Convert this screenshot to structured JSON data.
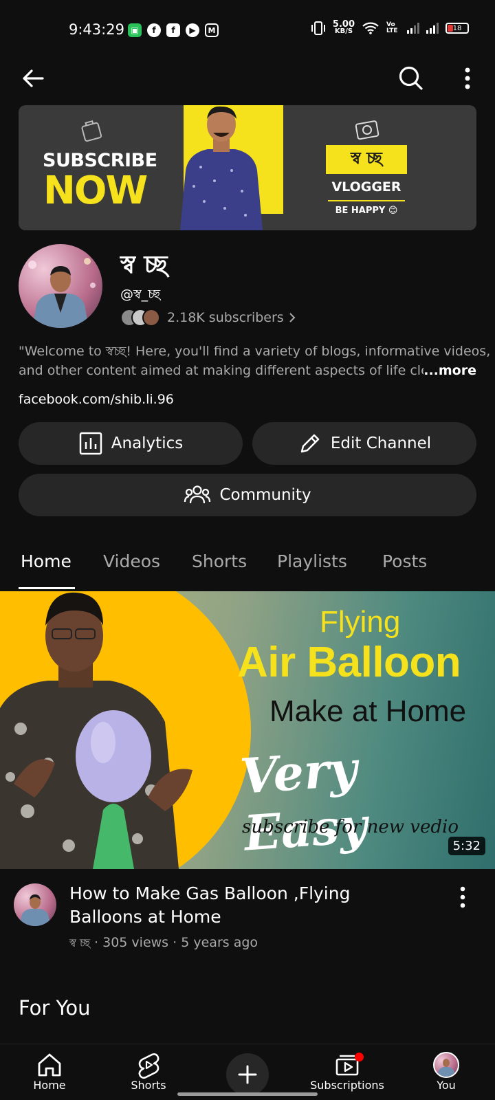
{
  "status_bar": {
    "time": "9:43:29",
    "notif_icons": [
      "app-icon",
      "facebook-icon",
      "facebook-square-icon",
      "youtube-icon",
      "gmail-icon"
    ],
    "speed_value": "5.00",
    "speed_unit": "KB/S",
    "volte": "Vo\nLTE",
    "battery": "18"
  },
  "banner": {
    "subscribe": "SUBSCRIBE",
    "now": "NOW",
    "brand": "স্ব চ্ছ",
    "vlogger": "VLOGGER",
    "tagline": "BE HAPPY 😊"
  },
  "channel": {
    "name": "স্ব চ্ছ",
    "handle": "@স্ব_চ্ছ",
    "subscribers": "2.18K subscribers",
    "description_line1": "\"Welcome to স্বচ্ছ! Here, you'll find a variety of blogs, informative videos,",
    "description_line2": "and other content aimed at making different aspects of life clea",
    "more_label": "...more",
    "link": "facebook.com/shib.li.96"
  },
  "buttons": {
    "analytics": "Analytics",
    "edit_channel": "Edit Channel",
    "community": "Community"
  },
  "tabs": [
    {
      "label": "Home",
      "active": true
    },
    {
      "label": "Videos",
      "active": false
    },
    {
      "label": "Shorts",
      "active": false
    },
    {
      "label": "Playlists",
      "active": false
    },
    {
      "label": "Posts",
      "active": false
    }
  ],
  "featured_video": {
    "thumb_line1": "Flying",
    "thumb_line2": "Air Balloon",
    "thumb_line3": "Make at Home",
    "thumb_line4": "Very Easy",
    "thumb_line5": "subscribe for new vedio",
    "duration": "5:32",
    "title": "How to Make Gas Balloon ,Flying Balloons at Home",
    "channel": "স্ব চ্ছ",
    "views": "305 views",
    "age": "5 years ago"
  },
  "section_title": "For You",
  "bottom_nav": {
    "home": "Home",
    "shorts": "Shorts",
    "subscriptions": "Subscriptions",
    "you": "You"
  },
  "colors": {
    "background": "#0f0f0f",
    "chip": "#272727",
    "secondary_text": "#aaaaaa",
    "banner_yellow": "#f5e11c",
    "notification_red": "#ff0000"
  }
}
